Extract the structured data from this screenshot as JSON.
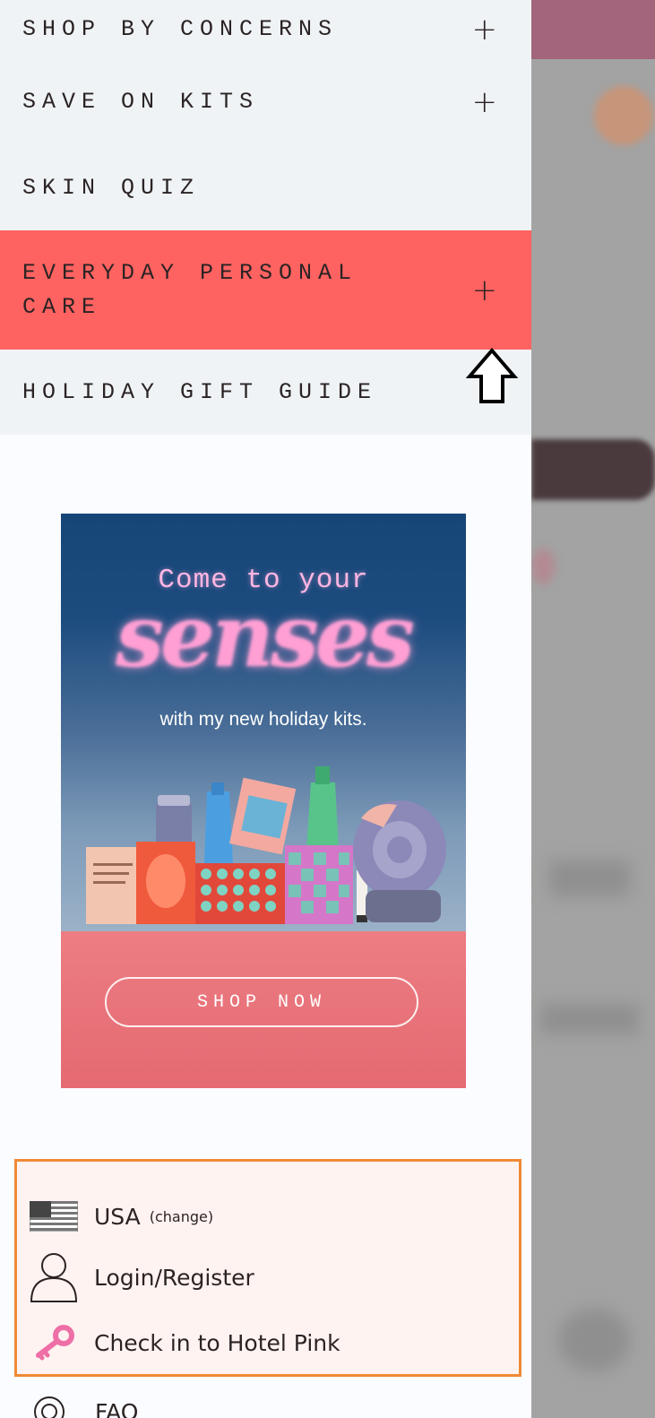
{
  "menu": {
    "items": [
      {
        "label": "SHOP BY CONCERNS",
        "expand": "+"
      },
      {
        "label": "SAVE ON KITS",
        "expand": "+"
      },
      {
        "label": "SKIN QUIZ"
      },
      {
        "label": "EVERYDAY PERSONAL CARE",
        "expand": "+"
      },
      {
        "label": "HOLIDAY GIFT GUIDE"
      }
    ]
  },
  "promo": {
    "line1": "Come to your",
    "big": "senses",
    "sub": "with my new holiday kits.",
    "button": "SHOP NOW"
  },
  "account": {
    "country": "USA",
    "change": "(change)",
    "login": "Login/Register",
    "hotel": "Check in to Hotel Pink"
  },
  "faq": {
    "label": "FAQ"
  },
  "colors": {
    "highlight": "#ff6361",
    "box_border": "#f08a35",
    "accent_pink": "#ee6fa6"
  },
  "icons": [
    "plus-icon",
    "us-flag-icon",
    "user-icon",
    "key-icon",
    "lifebuoy-icon",
    "cursor-arrow-icon"
  ]
}
